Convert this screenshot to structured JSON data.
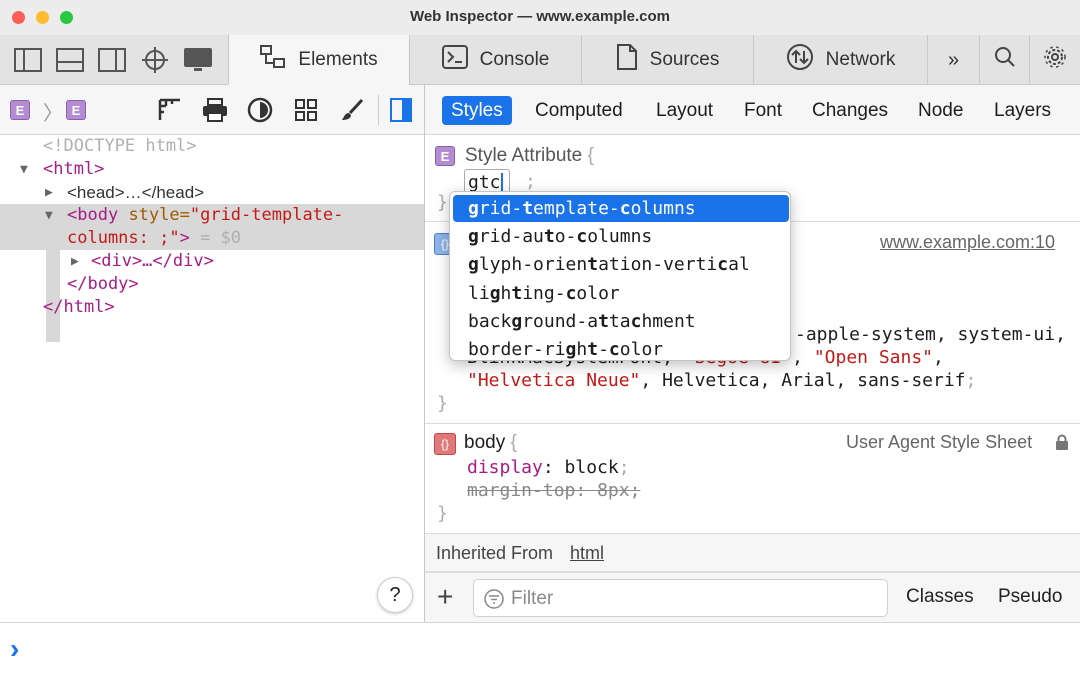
{
  "window": {
    "title": "Web Inspector — www.example.com",
    "lights": {
      "close": "#fe5f57",
      "minimize": "#febc2e",
      "zoom": "#28c840"
    }
  },
  "tabs": [
    {
      "label": "Elements",
      "icon": "elements-icon",
      "active": true
    },
    {
      "label": "Console",
      "icon": "console-icon"
    },
    {
      "label": "Sources",
      "icon": "sources-icon"
    },
    {
      "label": "Network",
      "icon": "network-icon"
    }
  ],
  "breadcrumb": {
    "badge": "E",
    "badge2": "E"
  },
  "dom": {
    "doctype": "<!DOCTYPE html>",
    "html_open": "<html>",
    "head": "<head>…</head>",
    "body_tag_open": "<body",
    "body_attr": "style=",
    "body_val1": "\"grid-template-",
    "body_val2": "columns: ;\"",
    "body_close": ">",
    "body_eq": " = $0",
    "div": "<div>…</div>",
    "body_end": "</body>",
    "html_end": "</html>"
  },
  "style_tabs": [
    "Styles",
    "Computed",
    "Layout",
    "Font",
    "Changes",
    "Node",
    "Layers"
  ],
  "style_attr": {
    "badge": "E",
    "label": "Style Attribute",
    "brace": "{",
    "typed": "gtc",
    "semi": ";",
    "close": "}"
  },
  "rule1": {
    "source": "www.example.com:10",
    "brace_open": "{",
    "line_a": "-apple-system, system-ui,",
    "line_b_pre": "BlinkMacSystemFont, ",
    "line_b_s1": "\"Segoe UI\"",
    "line_b_mid": ", ",
    "line_b_s2": "\"Open Sans\"",
    "line_b_end": ",",
    "line_c_s": "\"Helvetica Neue\"",
    "line_c_rest": ", Helvetica, Arial, sans-serif",
    "line_c_semi": ";",
    "close": "}"
  },
  "rule2": {
    "selector": "body",
    "brace": "{",
    "source": "User Agent Style Sheet",
    "p1": "display",
    "v1": "block",
    "p2": "margin-top",
    "v2": "8px",
    "close": "}"
  },
  "inherited": {
    "label": "Inherited From ",
    "link": "html"
  },
  "filter": {
    "placeholder": "Filter",
    "classes": "Classes",
    "pseudo": "Pseudo"
  },
  "suggestions": [
    {
      "pre": "",
      "b1": "g",
      "m1": "rid-",
      "b2": "t",
      "m2": "emplate-",
      "b3": "c",
      "m3": "olumns",
      "selected": true
    },
    {
      "pre": "",
      "b1": "g",
      "m1": "rid-au",
      "b2": "t",
      "m2": "o-",
      "b3": "c",
      "m3": "olumns"
    },
    {
      "pre": "",
      "b1": "g",
      "m1": "lyph-orien",
      "b2": "t",
      "m2": "ation-verti",
      "b3": "c",
      "m3": "al"
    },
    {
      "pre": "li",
      "b1": "g",
      "m1": "h",
      "b2": "t",
      "m2": "ing-",
      "b3": "c",
      "m3": "olor"
    },
    {
      "pre": "back",
      "b1": "g",
      "m1": "round-a",
      "b2": "t",
      "m2": "ta",
      "b3": "c",
      "m3": "hment"
    },
    {
      "pre": "border-ri",
      "b1": "g",
      "m1": "h",
      "b2": "t",
      "m2": "-",
      "b3": "c",
      "m3": "olor"
    }
  ],
  "help": "?",
  "console_prompt": "›"
}
